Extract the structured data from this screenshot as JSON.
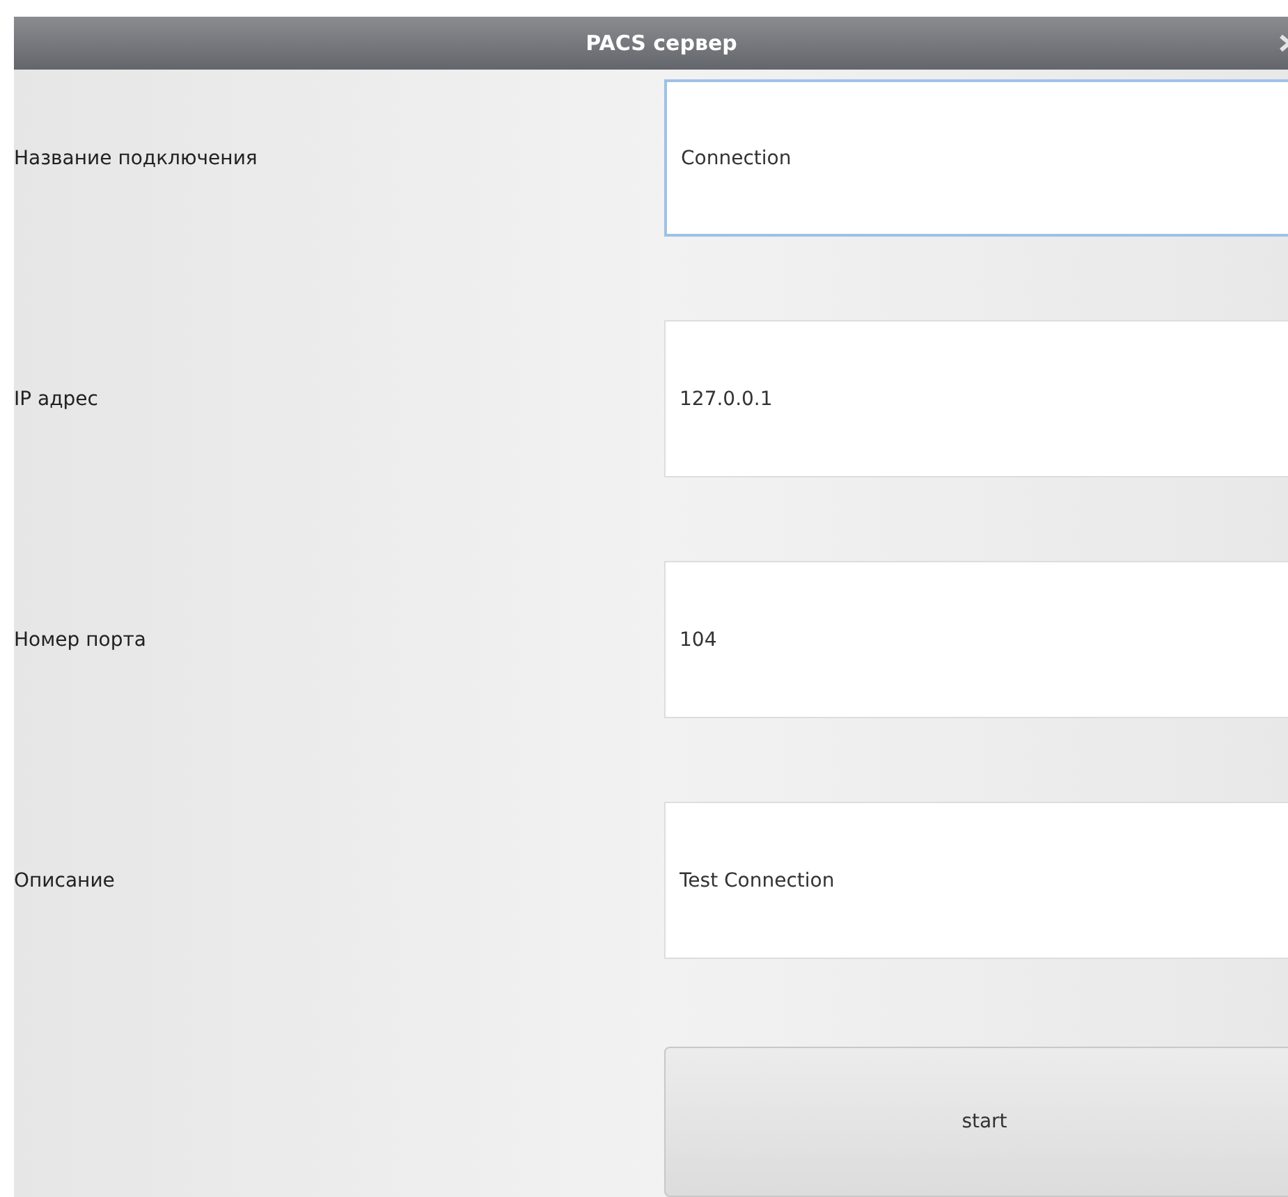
{
  "window": {
    "title": "PACS сервер"
  },
  "fields": [
    {
      "label": "Название подключения",
      "value": "Connection",
      "focused": true
    },
    {
      "label": "IP адрес",
      "value": "127.0.0.1",
      "focused": false
    },
    {
      "label": "Номер порта",
      "value": "104",
      "focused": false
    },
    {
      "label": "Описание",
      "value": "Test Connection",
      "focused": false
    }
  ],
  "button": {
    "label": "start"
  }
}
